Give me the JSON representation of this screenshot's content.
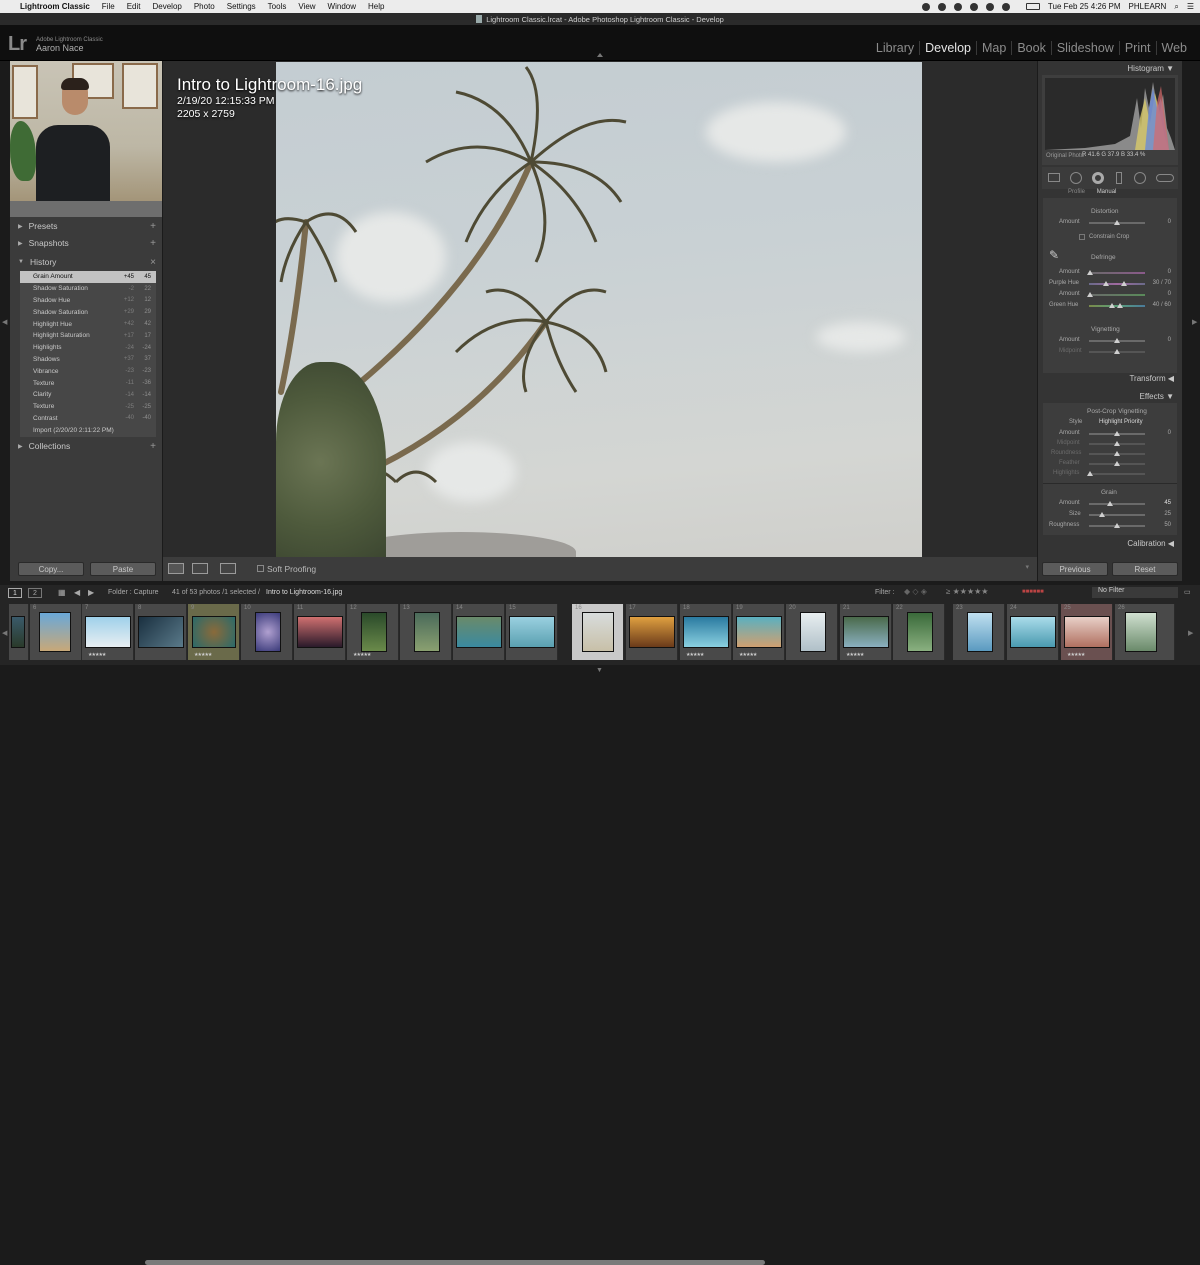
{
  "menubar": {
    "app_name": "Lightroom Classic",
    "items": [
      "File",
      "Edit",
      "Develop",
      "Photo",
      "Settings",
      "Tools",
      "View",
      "Window",
      "Help"
    ],
    "datetime": "Tue Feb 25  4:26 PM",
    "user": "PHLEARN"
  },
  "window_title": "Lightroom Classic.lrcat - Adobe Photoshop Lightroom Classic - Develop",
  "identity": {
    "logo": "Lr",
    "product": "Adobe Lightroom Classic",
    "user_name": "Aaron Nace"
  },
  "modules": [
    "Library",
    "Develop",
    "Map",
    "Book",
    "Slideshow",
    "Print",
    "Web"
  ],
  "active_module": "Develop",
  "left_panel": {
    "presets": "Presets",
    "snapshots": "Snapshots",
    "history": "History",
    "history_close": "×",
    "collections": "Collections",
    "history_items": [
      {
        "name": "Grain Amount",
        "delta": "+45",
        "value": "45"
      },
      {
        "name": "Shadow Saturation",
        "delta": "-2",
        "value": "22"
      },
      {
        "name": "Shadow Hue",
        "delta": "+12",
        "value": "12"
      },
      {
        "name": "Shadow Saturation",
        "delta": "+29",
        "value": "29"
      },
      {
        "name": "Highlight Hue",
        "delta": "+42",
        "value": "42"
      },
      {
        "name": "Highlight Saturation",
        "delta": "+17",
        "value": "17"
      },
      {
        "name": "Highlights",
        "delta": "-24",
        "value": "-24"
      },
      {
        "name": "Shadows",
        "delta": "+37",
        "value": "37"
      },
      {
        "name": "Vibrance",
        "delta": "-23",
        "value": "-23"
      },
      {
        "name": "Texture",
        "delta": "-11",
        "value": "-36"
      },
      {
        "name": "Clarity",
        "delta": "-14",
        "value": "-14"
      },
      {
        "name": "Texture",
        "delta": "-25",
        "value": "-25"
      },
      {
        "name": "Contrast",
        "delta": "-40",
        "value": "-40"
      },
      {
        "name": "Import (2/20/20 2:11:22 PM)",
        "delta": "",
        "value": ""
      }
    ],
    "copy_button": "Copy...",
    "paste_button": "Paste"
  },
  "photo_info": {
    "filename": "Intro to Lightroom-16.jpg",
    "datetime": "2/19/20 12:15:33 PM",
    "dimensions": "2205 x 2759"
  },
  "toolbar": {
    "soft_proofing": "Soft Proofing"
  },
  "right_panel": {
    "histogram_label": "Histogram",
    "rgb_readout": "R  41.6  G  37.9  B  33.4 %",
    "original_photo": "Original Photo",
    "tabs": [
      "Profile",
      "Manual"
    ],
    "distortion": {
      "title": "Distortion",
      "amount_label": "Amount",
      "amount_value": "0",
      "constrain": "Constrain Crop"
    },
    "defringe": {
      "title": "Defringe",
      "rows": [
        {
          "label": "Amount",
          "value": "0"
        },
        {
          "label": "Purple Hue",
          "value": "30 / 70"
        },
        {
          "label": "Amount",
          "value": "0"
        },
        {
          "label": "Green Hue",
          "value": "40 / 60"
        }
      ]
    },
    "vignetting": {
      "title": "Vignetting",
      "rows": [
        {
          "label": "Amount",
          "value": "0"
        },
        {
          "label": "Midpoint",
          "value": ""
        }
      ]
    },
    "transform": "Transform",
    "effects": "Effects",
    "post_crop": {
      "title": "Post-Crop Vignetting",
      "style_label": "Style",
      "style_value": "Highlight Priority",
      "rows": [
        {
          "label": "Amount",
          "value": "0"
        },
        {
          "label": "Midpoint",
          "value": ""
        },
        {
          "label": "Roundness",
          "value": ""
        },
        {
          "label": "Feather",
          "value": ""
        },
        {
          "label": "Highlights",
          "value": ""
        }
      ]
    },
    "grain": {
      "title": "Grain",
      "rows": [
        {
          "label": "Amount",
          "value": "45"
        },
        {
          "label": "Size",
          "value": "25"
        },
        {
          "label": "Roughness",
          "value": "50"
        }
      ]
    },
    "calibration": "Calibration",
    "previous_button": "Previous",
    "reset_button": "Reset"
  },
  "filmbar": {
    "screen1": "1",
    "screen2": "2",
    "folder": "Folder : Capture",
    "count": "41 of 53 photos /1 selected /",
    "current": "Intro to Lightroom-16.jpg",
    "filter_label": "Filter :",
    "filter_value": "No Filter"
  },
  "filmstrip": {
    "numbers": [
      "6",
      "7",
      "8",
      "9",
      "10",
      "11",
      "12",
      "13",
      "14",
      "15",
      "16",
      "17",
      "18",
      "19",
      "20",
      "21",
      "22",
      "23",
      "24",
      "25",
      "26"
    ],
    "selected_index": 10
  }
}
